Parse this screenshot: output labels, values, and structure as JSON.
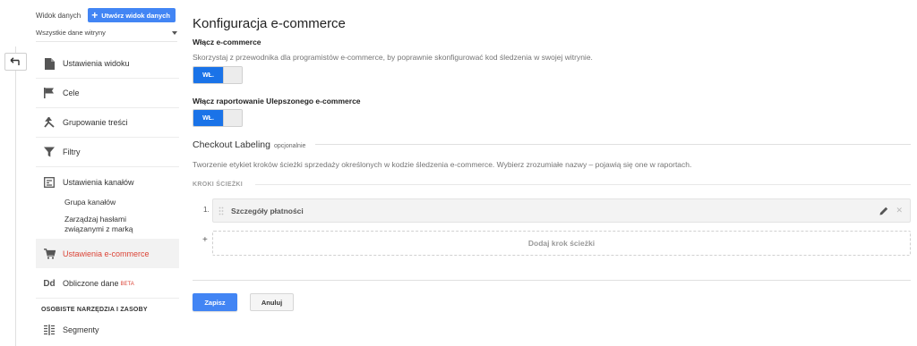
{
  "sidebar": {
    "view_label": "Widok danych",
    "create_view_button": "Utwórz widok danych",
    "view_select_value": "Wszystkie dane witryny",
    "items": [
      {
        "label": "Ustawienia widoku",
        "icon": "document-icon"
      },
      {
        "label": "Cele",
        "icon": "flag-icon"
      },
      {
        "label": "Grupowanie treści",
        "icon": "content-grouping-icon"
      },
      {
        "label": "Filtry",
        "icon": "filter-icon"
      },
      {
        "label": "Ustawienia kanałów",
        "icon": "channel-settings-icon"
      },
      {
        "label": "Ustawienia e-commerce",
        "icon": "cart-icon",
        "active": true
      },
      {
        "label": "Obliczone dane",
        "icon": "dd-icon",
        "badge": "BETA"
      }
    ],
    "sub_items": [
      "Grupa kanałów",
      "Zarządzaj hasłami związanymi z marką"
    ],
    "section_title": "OSOBISTE NARZĘDZIA I ZASOBY",
    "segments_label": "Segmenty"
  },
  "main": {
    "title": "Konfiguracja e-commerce",
    "ecommerce": {
      "label": "Włącz e-commerce",
      "description": "Skorzystaj z przewodnika dla programistów e-commerce, by poprawnie skonfigurować kod śledzenia w swojej witrynie.",
      "toggle_label": "WŁ."
    },
    "enhanced": {
      "label": "Włącz raportowanie Ulepszonego e-commerce",
      "toggle_label": "WŁ."
    },
    "checkout": {
      "title": "Checkout Labeling",
      "optional": "opcjonalnie",
      "description": "Tworzenie etykiet kroków ścieżki sprzedaży określonych w kodzie śledzenia e-commerce. Wybierz zrozumiałe nazwy – pojawią się one w raportach.",
      "steps_header": "KROKI ŚCIEŻKI",
      "steps": [
        {
          "number": "1.",
          "name": "Szczegóły płatności"
        }
      ],
      "add_step": "Dodaj krok ścieżki",
      "add_plus": "+"
    },
    "buttons": {
      "save": "Zapisz",
      "cancel": "Anuluj"
    }
  },
  "colors": {
    "accent": "#4285f4",
    "toggle_on": "#1a73e8",
    "active_text": "#db4437"
  }
}
